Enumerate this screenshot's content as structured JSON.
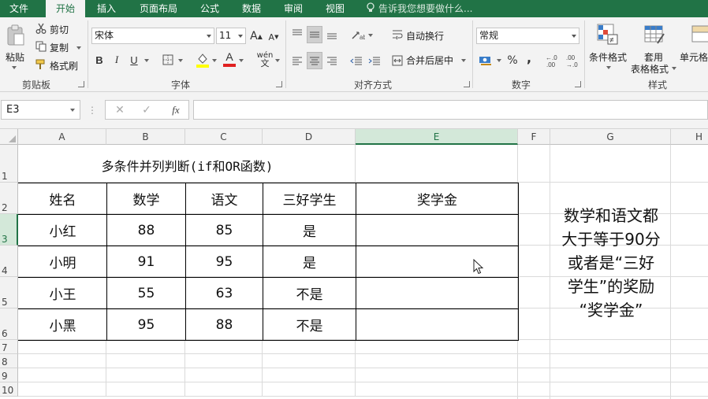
{
  "ribbon_tabs": [
    "文件",
    "开始",
    "插入",
    "页面布局",
    "公式",
    "数据",
    "审阅",
    "视图"
  ],
  "active_tab": "开始",
  "tell_me": "告诉我您想要做什么...",
  "clipboard": {
    "paste": "粘贴",
    "cut": "剪切",
    "copy": "复制",
    "format_painter": "格式刷",
    "group": "剪贴板"
  },
  "font": {
    "name": "宋体",
    "size": "11",
    "grow": "A",
    "shrink": "A",
    "bold": "B",
    "italic": "I",
    "underline": "U",
    "font_color": "A",
    "phonetic": "wén",
    "group": "字体"
  },
  "alignment": {
    "wrap_text": "自动换行",
    "merge_center": "合并后居中",
    "group": "对齐方式"
  },
  "number": {
    "format": "常规",
    "percent": "%",
    "comma": ",",
    "inc_decimal": "←.0 .00",
    "dec_decimal": ".00 →.0",
    "group": "数字"
  },
  "styles": {
    "conditional": "条件格式",
    "table_format_1": "套用",
    "table_format_2": "表格格式",
    "cell_styles": "单元格",
    "group": "样式"
  },
  "formula_bar": {
    "name_box": "E3",
    "cancel": "✕",
    "enter": "✓",
    "fx": "fx",
    "value": ""
  },
  "columns": [
    "A",
    "B",
    "C",
    "D",
    "E",
    "F",
    "G",
    "H"
  ],
  "rows": [
    "1",
    "2",
    "3",
    "4",
    "5",
    "6",
    "7",
    "8",
    "9",
    "10"
  ],
  "selected_cell": {
    "column": "E",
    "row": "3"
  },
  "sheet": {
    "title": "多条件并列判断(if和OR函数)",
    "headers": [
      "姓名",
      "数学",
      "语文",
      "三好学生",
      "奖学金"
    ],
    "records": [
      [
        "小红",
        "88",
        "85",
        "是",
        ""
      ],
      [
        "小明",
        "91",
        "95",
        "是",
        ""
      ],
      [
        "小王",
        "55",
        "63",
        "不是",
        ""
      ],
      [
        "小黑",
        "95",
        "88",
        "不是",
        ""
      ]
    ],
    "note_lines": [
      "数学和语文都",
      "大于等于90分",
      "或者是“三好",
      "学生”的奖励",
      "“奖学金”"
    ]
  },
  "colors": {
    "accent": "#217346",
    "ribbon": "#f3f3f3",
    "gridline": "#dadada"
  }
}
